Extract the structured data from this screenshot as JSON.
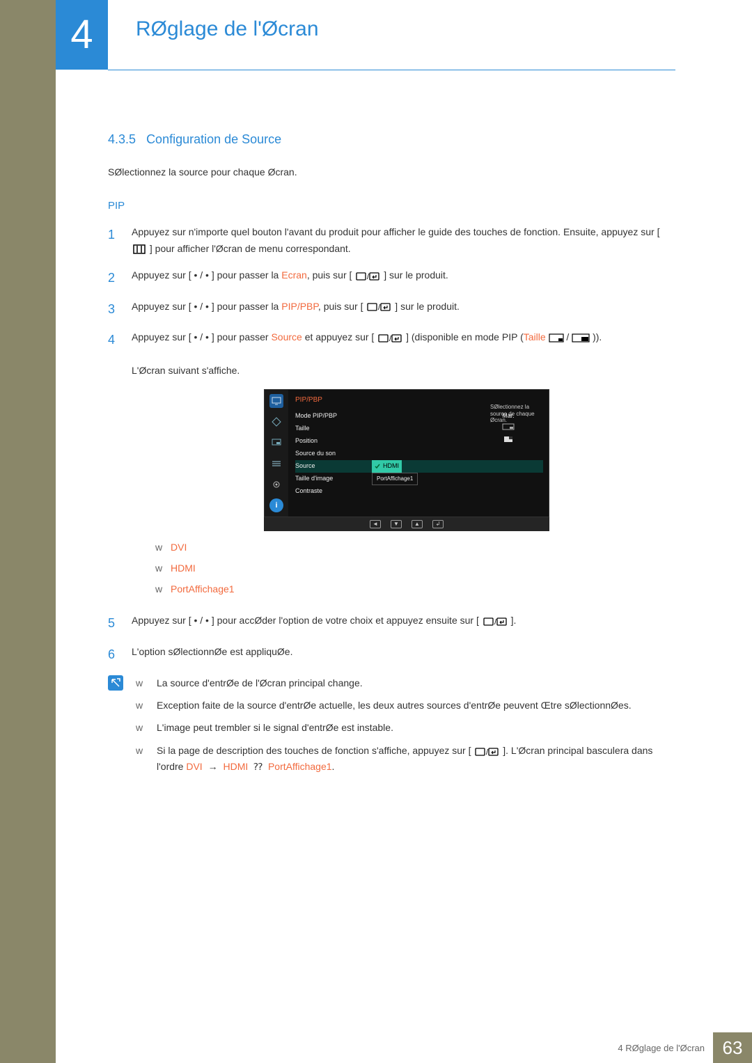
{
  "chapter": {
    "number": "4",
    "title": "RØglage de l'Øcran"
  },
  "section": {
    "number": "4.3.5",
    "title": "Configuration de Source"
  },
  "intro": "SØlectionnez la source pour chaque Øcran.",
  "subsection_title": "PIP",
  "steps": {
    "s1a": "Appuyez sur n'importe quel bouton  l'avant du produit pour afficher le guide des touches de fonction. Ensuite, appuyez sur [",
    "s1b": "] pour afficher l'Øcran de menu correspondant.",
    "s2a": "Appuyez sur [  •  /  •  ] pour passer  la ",
    "s2_hl": "Ecran",
    "s2b": ", puis sur [",
    "s2c": "] sur le produit.",
    "s3a": "Appuyez sur [  •  /  •  ] pour passer  la ",
    "s3_hl": "PIP/PBP",
    "s3b": ", puis sur [",
    "s3c": "] sur le produit.",
    "s4a": "Appuyez sur [  •  /  •  ] pour passer  ",
    "s4_hl1": "Source",
    "s4b": " et appuyez sur [",
    "s4c": "] (disponible en mode PIP (",
    "s4_hl2": "Taille",
    "s4d": ")).",
    "s4_after": "L'Øcran suivant s'affiche.",
    "s5a": "Appuyez sur [  •  /  •  ] pour accØder  l'option de votre choix et appuyez ensuite sur [",
    "s5b": "].",
    "s6": "L'option sØlectionnØe est appliquØe."
  },
  "osd": {
    "title": "PIP/PBP",
    "rows": {
      "mode": "Mode PIP/PBP",
      "mode_val": "Mar.",
      "taille": "Taille",
      "position": "Position",
      "son": "Source du son",
      "source": "Source",
      "source_val": "HDMI",
      "timg": "Taille d'image",
      "timg_val": "PortAffichage1",
      "contraste": "Contraste"
    },
    "desc": "SØlectionnez la source de chaque Øcran."
  },
  "sources": {
    "dvi": "DVI",
    "hdmi": "HDMI",
    "dp1": "PortAffichage1"
  },
  "notes": {
    "n1": "La source d'entrØe de l'Øcran principal change.",
    "n2": "Exception faite de la source d'entrØe actuelle, les deux autres sources d'entrØe peuvent Œtre sØlectionnØes.",
    "n3": "L'image peut trembler si le signal d'entrØe est instable.",
    "n4a": "Si la page de description des touches de fonction s'affiche, appuyez sur [",
    "n4b": "]. L'Øcran principal basculera dans l'ordre ",
    "n4_dvi": "DVI",
    "n4_hdmi": "HDMI",
    "n4_dp": "PortAffichage1",
    "n4c": "."
  },
  "footer": {
    "text": "4 RØglage de l'Øcran",
    "page": "63"
  },
  "bullet": "w"
}
